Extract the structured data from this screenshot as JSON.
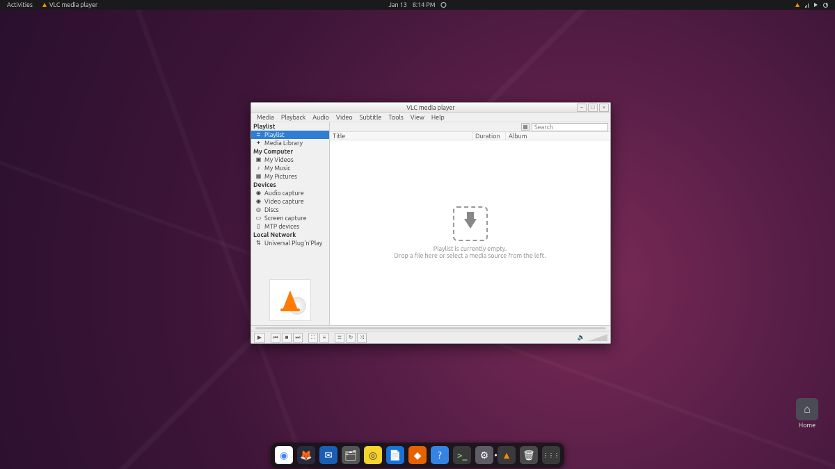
{
  "panel": {
    "activities": "Activities",
    "app_name": "VLC media player",
    "date": "Jan 13",
    "time": "8:14 PM"
  },
  "desktop": {
    "home_label": "Home"
  },
  "window": {
    "title": "VLC media player",
    "menu": [
      "Media",
      "Playback",
      "Audio",
      "Video",
      "Subtitle",
      "Tools",
      "View",
      "Help"
    ],
    "search_placeholder": "Search",
    "columns": {
      "title": "Title",
      "duration": "Duration",
      "album": "Album"
    },
    "empty1": "Playlist is currently empty.",
    "empty2": "Drop a file here or select a media source from the left.",
    "sidebar": {
      "sections": [
        {
          "header": "Playlist",
          "items": [
            {
              "label": "Playlist",
              "icon": "≣",
              "selected": true
            },
            {
              "label": "Media Library",
              "icon": "✦"
            }
          ]
        },
        {
          "header": "My Computer",
          "items": [
            {
              "label": "My Videos",
              "icon": "▣"
            },
            {
              "label": "My Music",
              "icon": "♪"
            },
            {
              "label": "My Pictures",
              "icon": "▦"
            }
          ]
        },
        {
          "header": "Devices",
          "items": [
            {
              "label": "Audio capture",
              "icon": "◉"
            },
            {
              "label": "Video capture",
              "icon": "◉"
            },
            {
              "label": "Discs",
              "icon": "◎"
            },
            {
              "label": "Screen capture",
              "icon": "▭"
            },
            {
              "label": "MTP devices",
              "icon": "▯"
            }
          ]
        },
        {
          "header": "Local Network",
          "items": [
            {
              "label": "Universal Plug'n'Play",
              "icon": "⇅"
            }
          ]
        }
      ]
    }
  },
  "dock": [
    {
      "name": "chrome",
      "bg": "#fff",
      "glyph": "◉",
      "color": "#4285f4"
    },
    {
      "name": "firefox",
      "bg": "#2a2a3a",
      "glyph": "🦊"
    },
    {
      "name": "thunderbird",
      "bg": "#1a5fb4",
      "glyph": "✉"
    },
    {
      "name": "files",
      "bg": "#555",
      "glyph": "🗂"
    },
    {
      "name": "rhythmbox",
      "bg": "#f6d32d",
      "glyph": "◎",
      "color": "#333"
    },
    {
      "name": "writer",
      "bg": "#1c71d8",
      "glyph": "📄"
    },
    {
      "name": "software",
      "bg": "#e66100",
      "glyph": "◆"
    },
    {
      "name": "help",
      "bg": "#3584e4",
      "glyph": "?"
    },
    {
      "name": "terminal",
      "bg": "#3a3a3a",
      "glyph": ">_",
      "color": "#9f9"
    },
    {
      "name": "settings",
      "bg": "#5e5c64",
      "glyph": "⚙"
    },
    {
      "name": "vlc",
      "bg": "#3a3a3a",
      "glyph": "▲",
      "color": "#ff8c00",
      "active": true
    },
    {
      "name": "trash",
      "bg": "#4a4a4a",
      "glyph": "🗑"
    },
    {
      "name": "apps",
      "bg": "#3a3a3a",
      "glyph": "⋮⋮⋮"
    }
  ]
}
